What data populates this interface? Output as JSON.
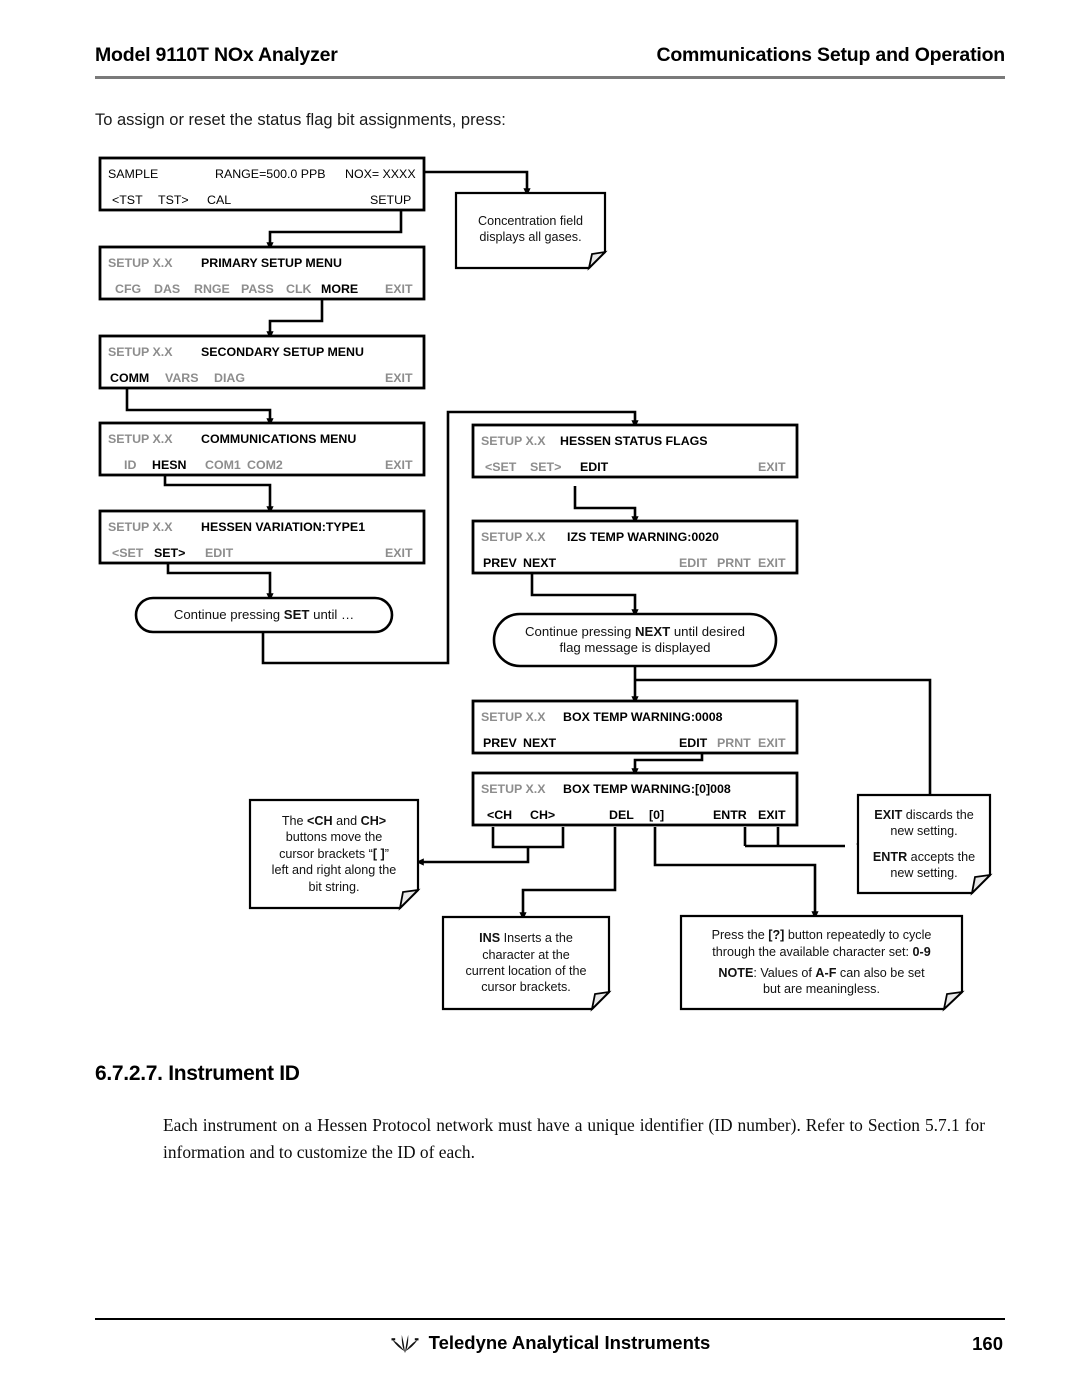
{
  "header": {
    "left_title": "Model 9110T NOx Analyzer",
    "right_title": "Communications Setup and Operation"
  },
  "intro": {
    "text": "To assign or reset the status flag bit assignments, press:"
  },
  "flowchart": {
    "panels": [
      {
        "id": "sample",
        "line1_left": "SAMPLE",
        "line1_mid": "RANGE=500.0 PPB",
        "line1_right": "NOX= XXXX",
        "btn_a": "<TST",
        "btn_b": "TST>",
        "btn_c": "CAL",
        "btn_right": "SETUP"
      },
      {
        "id": "primary-setup",
        "prefix": "SETUP X.X",
        "title": "PRIMARY SETUP MENU",
        "buttons": [
          "CFG",
          "DAS",
          "RNGE",
          "PASS",
          "CLK",
          "MORE"
        ],
        "active": "MORE",
        "exit": "EXIT"
      },
      {
        "id": "secondary-setup",
        "prefix": "SETUP X.X",
        "title": "SECONDARY SETUP MENU",
        "buttons": [
          "COMM",
          "VARS",
          "DIAG"
        ],
        "active": "COMM",
        "exit": "EXIT"
      },
      {
        "id": "communications-menu",
        "prefix": "SETUP X.X",
        "title": "COMMUNICATIONS MENU",
        "buttons": [
          "ID",
          "HESN",
          "COM1",
          "COM2"
        ],
        "active": "HESN",
        "exit": "EXIT"
      },
      {
        "id": "hessen-variation",
        "prefix": "SETUP X.X",
        "title": "HESSEN VARIATION:TYPE1",
        "buttons": [
          "<SET",
          "SET>",
          "EDIT"
        ],
        "active": "SET>",
        "exit": "EXIT"
      },
      {
        "id": "hessen-status-flags",
        "prefix": "SETUP X.X",
        "title": "HESSEN STATUS FLAGS",
        "buttons": [
          "<SET",
          "SET>",
          "EDIT"
        ],
        "active": "EDIT",
        "exit": "EXIT"
      },
      {
        "id": "izs-temp-warning",
        "prefix": "SETUP X.X",
        "title": "IZS TEMP WARNING:0020",
        "buttons": [
          "PREV",
          "NEXT"
        ],
        "right_buttons": [
          "EDIT",
          "PRNT",
          "EXIT"
        ],
        "active": "PREV NEXT"
      },
      {
        "id": "box-temp-warning",
        "prefix": "SETUP X.X",
        "title": "BOX TEMP WARNING:0008",
        "buttons": [
          "PREV",
          "NEXT"
        ],
        "right_buttons": [
          "EDIT",
          "PRNT",
          "EXIT"
        ],
        "active": "EDIT"
      },
      {
        "id": "box-temp-warning-edit",
        "prefix": "SETUP X.X",
        "title": "BOX TEMP WARNING:[0]008",
        "buttons": [
          "<CH",
          "CH>",
          "DEL",
          "[0]",
          "ENTR",
          "EXIT"
        ]
      }
    ],
    "bubbles": [
      {
        "id": "continue-set",
        "text_pre": "Continue pressing ",
        "bold": "SET",
        "text_post": " until …"
      },
      {
        "id": "continue-next",
        "line1_pre": "Continue pressing ",
        "line1_bold": "NEXT",
        "line1_post": " until desired",
        "line2": "flag message is displayed"
      }
    ],
    "notes": [
      {
        "id": "concentration-note",
        "line1": "Concentration field",
        "line2": "displays all gases."
      },
      {
        "id": "ch-buttons-note",
        "seg1": "The  ",
        "seg2": "<CH",
        "seg3": " and ",
        "seg4": "CH>",
        "seg5": "buttons move the",
        "seg6": "cursor brackets “",
        "seg7": "[  ]",
        "seg8": "”",
        "seg9": "left and right along the",
        "seg10": "bit string."
      },
      {
        "id": "ins-note",
        "bold": "INS",
        "line1": " Inserts a the",
        "line2": "character at the",
        "line3": "current location of  the",
        "line4": "cursor brackets."
      },
      {
        "id": "exit-entr-note",
        "p1_bold": "EXIT",
        "p1_text": " discards the",
        "p1_line2": "new setting.",
        "p2_bold": "ENTR",
        "p2_text": " accepts the",
        "p2_line2": "new setting."
      },
      {
        "id": "charset-note",
        "l1_pre": "Press the  ",
        "l1_bold": "[?]",
        "l1_post": " button repeatedly to cycle",
        "l2_pre": "through the available character set:  ",
        "l2_bold": "0-9",
        "l3_bold": "NOTE",
        "l3_mid": ": Values of ",
        "l3_bold2": "A-F",
        "l3_post": " can also be set",
        "l4": "but are meaningless."
      }
    ]
  },
  "section": {
    "number_title": "6.7.2.7. Instrument ID",
    "paragraph": "Each instrument on a Hessen Protocol network must have a unique identifier (ID number).  Refer to Section 5.7.1 for information and to customize the ID of each."
  },
  "footer": {
    "company": "Teledyne Analytical Instruments",
    "page_number": "160",
    "logo": "teledyne-logo-icon"
  }
}
